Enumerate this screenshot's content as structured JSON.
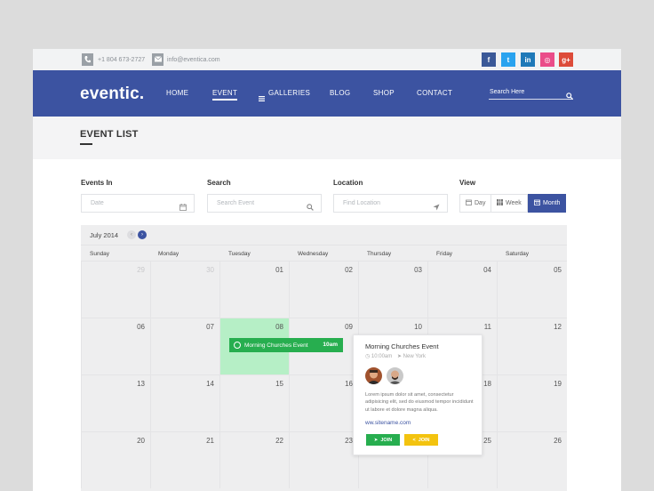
{
  "topbar": {
    "phone_icon": "phone-icon",
    "phone": "+1 804 673-2727",
    "email_icon": "envelope-icon",
    "email": "info@eventica.com",
    "social": [
      {
        "name": "facebook-icon",
        "glyph": "f",
        "color": "#3b5998"
      },
      {
        "name": "twitter-icon",
        "glyph": "t",
        "color": "#2aa3ef"
      },
      {
        "name": "linkedin-icon",
        "glyph": "in",
        "color": "#1f79b8"
      },
      {
        "name": "dribbble-icon",
        "glyph": "◎",
        "color": "#ea4c89"
      },
      {
        "name": "google-plus-icon",
        "glyph": "g+",
        "color": "#dd4b39"
      }
    ]
  },
  "nav": {
    "logo": "eventic.",
    "items": [
      "HOME",
      "EVENT",
      "GALLERIES",
      "BLOG",
      "SHOP",
      "CONTACT"
    ],
    "active": "EVENT",
    "search_placeholder": "Search Here"
  },
  "page": {
    "title": "EVENT LIST"
  },
  "filters": {
    "events_in": {
      "label": "Events In",
      "placeholder": "Date"
    },
    "search": {
      "label": "Search",
      "placeholder": "Search Event"
    },
    "location": {
      "label": "Location",
      "placeholder": "Find Location"
    },
    "view": {
      "label": "View",
      "options": [
        "Day",
        "Week",
        "Month"
      ],
      "selected": "Month"
    }
  },
  "calendar": {
    "month": "July 2014",
    "days": [
      "Sunday",
      "Monday",
      "Tuesday",
      "Wednesday",
      "Thursday",
      "Friday",
      "Saturday"
    ],
    "weeks": [
      [
        "29",
        "30",
        "01",
        "02",
        "03",
        "04",
        "05"
      ],
      [
        "06",
        "07",
        "08",
        "09",
        "10",
        "11",
        "12"
      ],
      [
        "13",
        "14",
        "15",
        "16",
        "17",
        "18",
        "19"
      ],
      [
        "20",
        "21",
        "22",
        "23",
        "24",
        "25",
        "26"
      ]
    ],
    "today": "08",
    "accent": "#3c53a1",
    "today_color": "#b6efc6"
  },
  "event": {
    "title": "Morning Churches Event",
    "time": "10am",
    "color": "#27ae4f"
  },
  "popup": {
    "title": "Morning Churches Event",
    "time": "10:00am",
    "location": "New York",
    "description": "Lorem ipsum dolor sit amet, consectetur adipisicing elit, sed do eiusmod tempor incididunt ut labore et dolore magna aliqua.",
    "link": "ww.sitename.com",
    "buttons": [
      {
        "label": "JOIN",
        "color": "#27ae4f",
        "icon": "paper-plane-icon"
      },
      {
        "label": "JOIN",
        "color": "#f3c30f",
        "icon": "share-icon"
      }
    ]
  }
}
